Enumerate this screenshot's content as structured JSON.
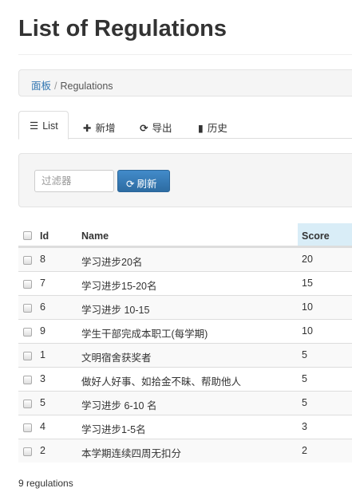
{
  "page": {
    "title": "List of Regulations"
  },
  "breadcrumb": {
    "home": "面板",
    "separator": "/",
    "current": "Regulations"
  },
  "tabs": [
    {
      "icon": "list-icon",
      "glyph": "☰",
      "label": "List",
      "active": true
    },
    {
      "icon": "plus-icon",
      "glyph": "✚",
      "label": "新增",
      "active": false
    },
    {
      "icon": "export-icon",
      "glyph": "⟳",
      "label": "导出",
      "active": false
    },
    {
      "icon": "book-icon",
      "glyph": "▮",
      "label": "历史",
      "active": false
    }
  ],
  "filter": {
    "placeholder": "过滤器",
    "refresh_icon": "refresh-icon",
    "refresh_glyph": "⟳",
    "refresh_label": "刷新"
  },
  "table": {
    "columns": {
      "id": "Id",
      "name": "Name",
      "score": "Score"
    },
    "sorted_column": "score",
    "rows": [
      {
        "id": "8",
        "name": "学习进步20名",
        "score": "20"
      },
      {
        "id": "7",
        "name": "学习进步15-20名",
        "score": "15"
      },
      {
        "id": "6",
        "name": "学习进步 10-15",
        "score": "10"
      },
      {
        "id": "9",
        "name": "学生干部完成本职工(每学期)",
        "score": "10"
      },
      {
        "id": "1",
        "name": "文明宿舍获奖者",
        "score": "5"
      },
      {
        "id": "3",
        "name": "做好人好事、如拾金不昧、帮助他人",
        "score": "5"
      },
      {
        "id": "5",
        "name": "学习进步 6-10 名",
        "score": "5"
      },
      {
        "id": "4",
        "name": "学习进步1-5名",
        "score": "3"
      },
      {
        "id": "2",
        "name": "本学期连续四周无扣分",
        "score": "2"
      }
    ]
  },
  "footer": {
    "count": "9 regulations"
  },
  "colors": {
    "link": "#3276b1",
    "primary": "#428bca",
    "sorted_header": "#d9edf7"
  }
}
